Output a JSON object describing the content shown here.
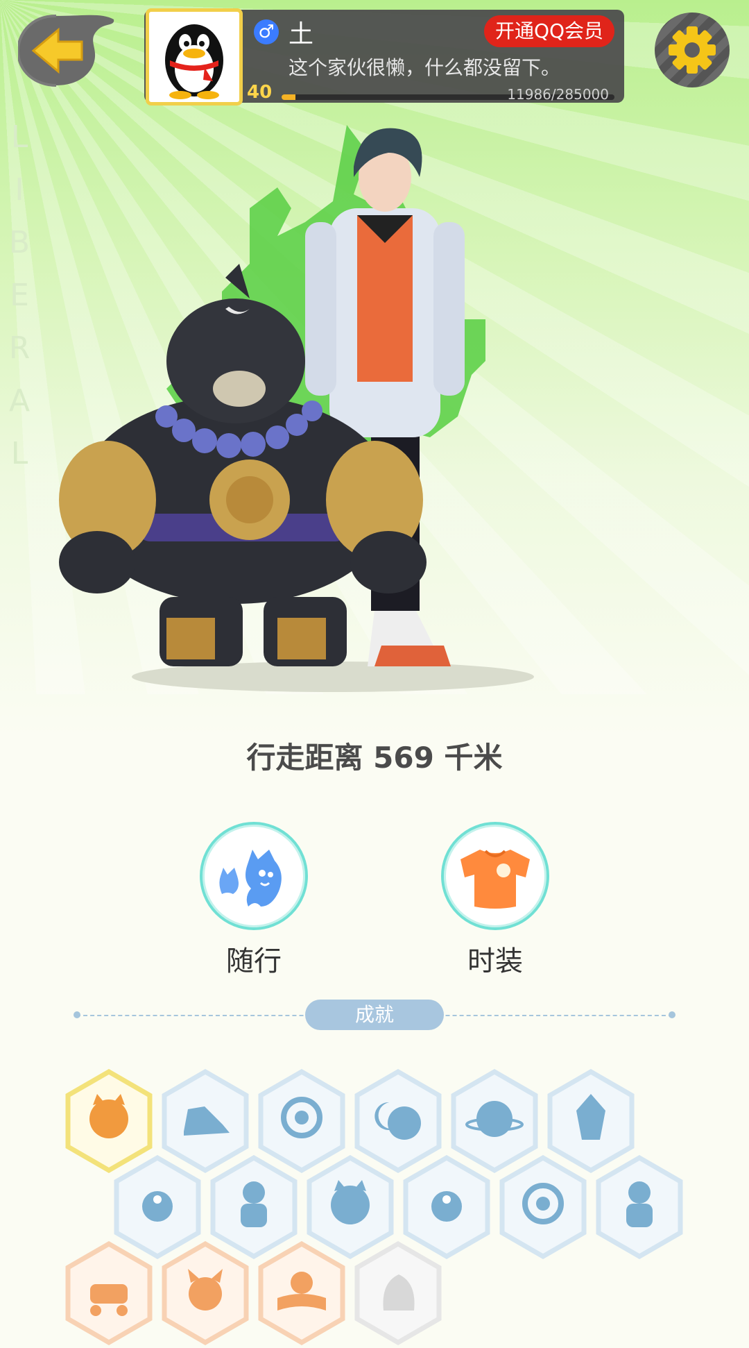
{
  "header": {
    "gender_symbol": "♂",
    "username": "土",
    "vip_button_label": "开通QQ会员",
    "signature": "这个家伙很懒，什么都没留下。",
    "level": "40",
    "xp_text": "11986/285000",
    "xp_progress": 0.042
  },
  "side_text": [
    "L",
    "I",
    "B",
    "E",
    "R",
    "A",
    "L"
  ],
  "stats": {
    "distance_text": "行走距离 569 千米"
  },
  "nav": {
    "companion_label": "随行",
    "fashion_label": "时装"
  },
  "achievements": {
    "title": "成就",
    "row1": [
      "active-cat-badge",
      "sneaker-badge",
      "target-badge",
      "moon-badge",
      "planet-badge",
      "crystal-badge"
    ],
    "row2": [
      "yinyang-wave-badge",
      "gingerbread-badge",
      "cat-wand-badge",
      "yinyang-box-badge",
      "shield-badge",
      "bear-badge"
    ],
    "row3": [
      "stroller-badge",
      "devil-badge",
      "book-badge",
      "dragon-locked-badge"
    ]
  },
  "colors": {
    "accent_yellow": "#f3c83c",
    "vip_red": "#e0241a",
    "teal_ring": "#70e0d4",
    "badge_blue": "#7aaed0",
    "badge_orange": "#f2a161"
  }
}
